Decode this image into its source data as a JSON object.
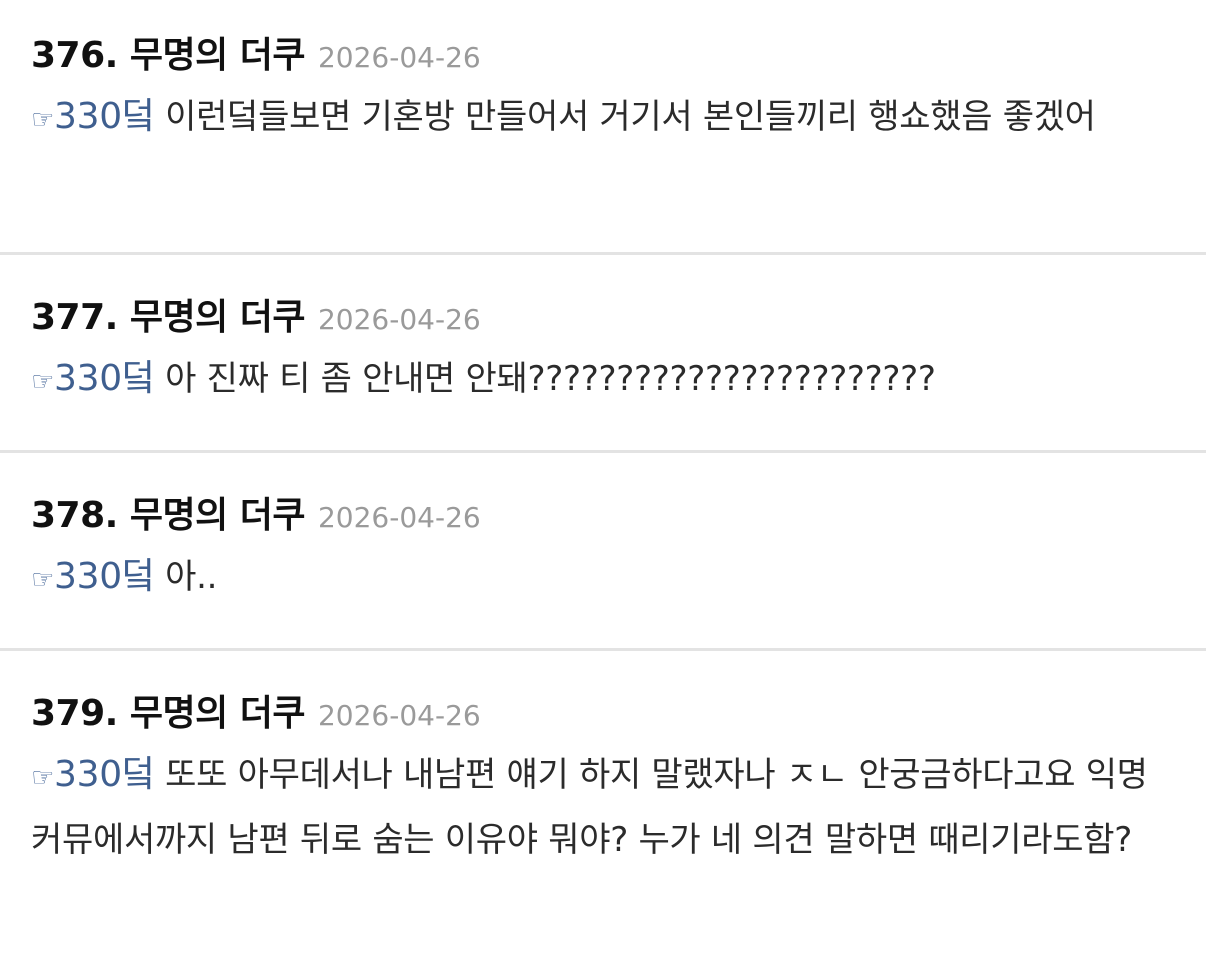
{
  "posts": [
    {
      "number": "376.",
      "author": "무명의 더쿠",
      "date": "2026-04-26",
      "reply_icon": "☞",
      "reply_ref": "330덬",
      "text": "이런덬들보면 기혼방 만들어서 거기서 본인들끼리 행쇼했음 좋겠어"
    },
    {
      "number": "377.",
      "author": "무명의 더쿠",
      "date": "2026-04-26",
      "reply_icon": "☞",
      "reply_ref": "330덬",
      "text": "아 진짜 티 좀 안내면 안돼???????????????????????"
    },
    {
      "number": "378.",
      "author": "무명의 더쿠",
      "date": "2026-04-26",
      "reply_icon": "☞",
      "reply_ref": "330덬",
      "text": "아.."
    },
    {
      "number": "379.",
      "author": "무명의 더쿠",
      "date": "2026-04-26",
      "reply_icon": "☞",
      "reply_ref": "330덬",
      "text": "또또 아무데서나 내남편 얘기 하지 말랬자나 ㅈㄴ 안궁금하다고요 익명 커뮤에서까지 남편 뒤로 숨는 이유야 뭐야? 누가 네 의견 말하면 때리기라도함?"
    }
  ]
}
